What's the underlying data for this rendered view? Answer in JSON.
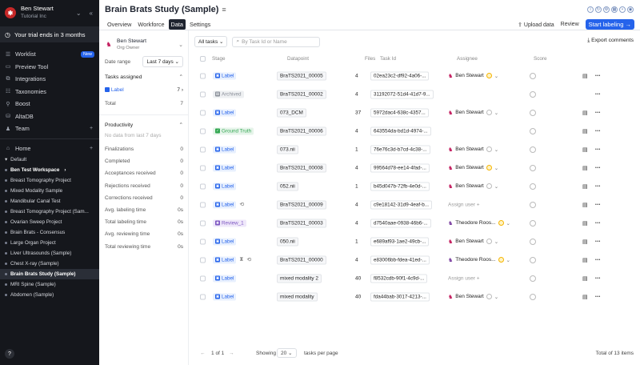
{
  "sidebar": {
    "user_name": "Ben Stewart",
    "org": "Tutorial Inc",
    "trial": "Your trial ends in 3 months",
    "nav": [
      {
        "label": "Worklist",
        "icon": "worklist-icon",
        "badge": "New"
      },
      {
        "label": "Preview Tool",
        "icon": "preview-icon"
      },
      {
        "label": "Integrations",
        "icon": "integrations-icon"
      },
      {
        "label": "Taxonomies",
        "icon": "taxonomies-icon"
      },
      {
        "label": "Boost",
        "icon": "boost-icon"
      },
      {
        "label": "AltaDB",
        "icon": "database-icon"
      },
      {
        "label": "Team",
        "icon": "team-icon"
      }
    ],
    "home": "Home",
    "default": "Default",
    "workspace": "Ben Test Workspace",
    "projects": [
      "Breast Tomography Project",
      "Mixed Modality Sample",
      "Mandibular Canal Test",
      "Breast Tomography Project (Sam...",
      "Ovarian Sweep Project",
      "Brain Brats - Consensus",
      "Large Organ Project",
      "Liver Ultrasounds (Sample)",
      "Chest X-ray (Sample)",
      "Brain Brats Study (Sample)",
      "MRI Spine (Sample)",
      "Abdomen (Sample)"
    ],
    "selected_project": "Brain Brats Study (Sample)",
    "help": "?"
  },
  "header": {
    "title": "Brain Brats Study (Sample)",
    "tabs": [
      "Overview",
      "Workforce",
      "Data",
      "Settings"
    ],
    "active_tab": "Data",
    "upload": "Upload data",
    "review": "Review",
    "start": "Start labeling →"
  },
  "filters": {
    "user_name": "Ben Stewart",
    "user_role": "Org Owner",
    "date_range_label": "Date range",
    "date_range_value": "Last 7 days",
    "tasks_assigned": "Tasks assigned",
    "label_chip": "Label",
    "label_count": "7",
    "total_label": "Total",
    "total_count": "7",
    "productivity": "Productivity",
    "no_data": "No data from last 7 days",
    "metrics": [
      {
        "label": "Finalizations",
        "value": "0"
      },
      {
        "label": "Completed",
        "value": "0"
      },
      {
        "label": "Acceptances received",
        "value": "0"
      },
      {
        "label": "Rejections received",
        "value": "0"
      },
      {
        "label": "Corrections received",
        "value": "0"
      },
      {
        "label": "Avg. labeling time",
        "value": "0s"
      },
      {
        "label": "Total labeling time",
        "value": "0s"
      },
      {
        "label": "Avg. reviewing time",
        "value": "0s"
      },
      {
        "label": "Total reviewing time",
        "value": "0s"
      }
    ]
  },
  "table": {
    "filter": "All tasks",
    "search_placeholder": "By Task Id or Name",
    "export": "Export comments",
    "columns": {
      "stage": "Stage",
      "datapoint": "Datapoint",
      "files": "Files",
      "task_id": "Task Id",
      "assignee": "Assignee",
      "score": "Score"
    },
    "rows": [
      {
        "stage": "Label",
        "stage_color": "#2563eb",
        "stage_bg": "#e8f0fe",
        "datapoint": "BraTS2021_00005",
        "files": "4",
        "task_id": "02ea23c2-df92-4a06-...",
        "assignee": "Ben Stewart",
        "status": "warn"
      },
      {
        "stage": "Archived",
        "stage_color": "#8a8f99",
        "stage_bg": "#eef0f2",
        "datapoint": "BraTS2021_00002",
        "files": "4",
        "task_id": "31192072-51d4-41d7-9...",
        "assignee": "",
        "status": ""
      },
      {
        "stage": "Label",
        "stage_color": "#2563eb",
        "stage_bg": "#e8f0fe",
        "datapoint": "073_DCM",
        "files": "37",
        "task_id": "5972dac4-638c-4357...",
        "assignee": "Ben Stewart",
        "status": "empty"
      },
      {
        "stage": "Ground Truth",
        "stage_color": "#34a853",
        "stage_bg": "#e6f4ea",
        "datapoint": "BraTS2021_00006",
        "files": "4",
        "task_id": "643554da-bd1d-4974-...",
        "assignee": "",
        "status": ""
      },
      {
        "stage": "Label",
        "stage_color": "#2563eb",
        "stage_bg": "#e8f0fe",
        "datapoint": "073.nii",
        "files": "1",
        "task_id": "76e76c3d-b7cd-4c38-...",
        "assignee": "Ben Stewart",
        "status": "empty"
      },
      {
        "stage": "Label",
        "stage_color": "#2563eb",
        "stage_bg": "#e8f0fe",
        "datapoint": "BraTS2021_00008",
        "files": "4",
        "task_id": "99564d78-ee14-4fad-...",
        "assignee": "Ben Stewart",
        "status": "warn"
      },
      {
        "stage": "Label",
        "stage_color": "#2563eb",
        "stage_bg": "#e8f0fe",
        "datapoint": "052.nii",
        "files": "1",
        "task_id": "b45d047b-72fb-4e0d-...",
        "assignee": "Ben Stewart",
        "status": "empty"
      },
      {
        "stage": "Label",
        "stage_color": "#2563eb",
        "stage_bg": "#e8f0fe",
        "datapoint": "BraTS2021_00009",
        "files": "4",
        "task_id": "c9e18142-31d9-4eaf-b...",
        "assignee": "Assign user +",
        "status": "",
        "extra": "consensus-icon"
      },
      {
        "stage": "Review_1",
        "stage_color": "#7e57c2",
        "stage_bg": "#efe8fa",
        "datapoint": "BraTS2021_00003",
        "files": "4",
        "task_id": "d7540aae-0938-46b6-...",
        "assignee": "Theodore Roos...",
        "status": "warn"
      },
      {
        "stage": "Label",
        "stage_color": "#2563eb",
        "stage_bg": "#e8f0fe",
        "datapoint": "050.nii",
        "files": "1",
        "task_id": "e689af93-1ae2-49cb-...",
        "assignee": "Ben Stewart",
        "status": "empty"
      },
      {
        "stage": "Label",
        "stage_color": "#2563eb",
        "stage_bg": "#e8f0fe",
        "datapoint": "BraTS2021_00000",
        "files": "4",
        "task_id": "e83006bb-fdea-41ed-...",
        "assignee": "Theodore Roos...",
        "status": "warn",
        "extra": "timer-consensus-icon"
      },
      {
        "stage": "Label",
        "stage_color": "#2563eb",
        "stage_bg": "#e8f0fe",
        "datapoint": "mixed modality 2",
        "files": "40",
        "task_id": "f8532cdb-90f1-4c9d-...",
        "assignee": "Assign user +",
        "status": ""
      },
      {
        "stage": "Label",
        "stage_color": "#2563eb",
        "stage_bg": "#e8f0fe",
        "datapoint": "mixed modality",
        "files": "40",
        "task_id": "fda44bab-3017-4213-...",
        "assignee": "Ben Stewart",
        "status": "empty"
      }
    ],
    "pager": {
      "page": "1",
      "of": "of 1",
      "showing": "Showing",
      "per_page": "20",
      "per_page_suffix": "tasks per page",
      "total": "Total of 13 items"
    }
  }
}
